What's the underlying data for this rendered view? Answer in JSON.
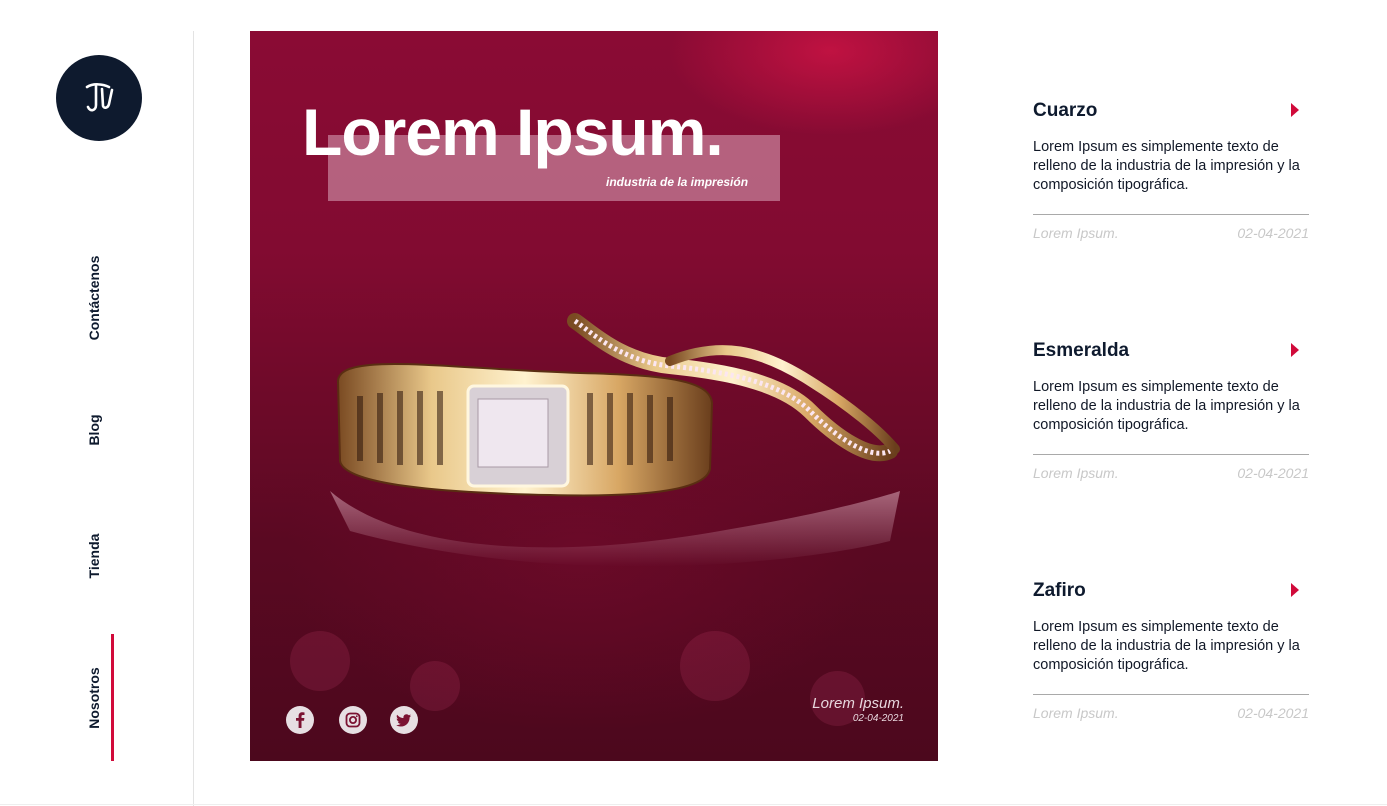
{
  "nav": {
    "items": [
      {
        "label": "Contáctenos"
      },
      {
        "label": "Blog"
      },
      {
        "label": "Tienda"
      },
      {
        "label": "Nosotros"
      }
    ],
    "active": "Nosotros",
    "accent_color": "#d10a3a"
  },
  "hero": {
    "title": "Lorem Ipsum.",
    "subtitle": "industria de la impresión",
    "caption_title": "Lorem Ipsum.",
    "caption_date": "02-04-2021",
    "social": [
      "facebook-icon",
      "instagram-icon",
      "twitter-icon"
    ]
  },
  "articles": [
    {
      "title": "Cuarzo",
      "text": "Lorem Ipsum es simplemente texto de relleno de la industria de la impresión y la composición tipográfica.",
      "meta_label": "Lorem Ipsum.",
      "date": "02-04-2021"
    },
    {
      "title": "Esmeralda",
      "text": "Lorem Ipsum es simplemente texto de relleno de la industria de la impresión y la composición tipográfica.",
      "meta_label": "Lorem Ipsum.",
      "date": "02-04-2021"
    },
    {
      "title": "Zafiro",
      "text": "Lorem Ipsum es simplemente texto de relleno de la industria de la impresión y la composición tipográfica.",
      "meta_label": "Lorem Ipsum.",
      "date": "02-04-2021"
    }
  ],
  "colors": {
    "navy": "#0e1a2e",
    "accent": "#d10a3a",
    "muted": "#c8c8c8"
  }
}
